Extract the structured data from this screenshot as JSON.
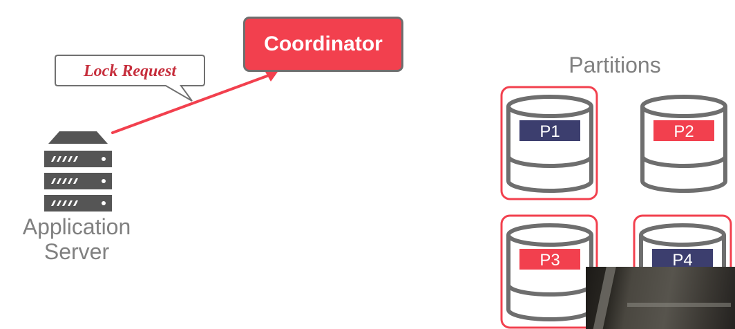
{
  "diagram": {
    "coordinator_label": "Coordinator",
    "callout_label": "Lock Request",
    "app_server_label": [
      "Application",
      "Server"
    ],
    "partitions_title": "Partitions",
    "partitions": [
      {
        "label": "P1",
        "band_color": "#3c3e6e",
        "highlighted": true
      },
      {
        "label": "P2",
        "band_color": "#f2404e",
        "highlighted": false
      },
      {
        "label": "P3",
        "band_color": "#f2404e",
        "highlighted": true
      },
      {
        "label": "P4",
        "band_color": "#3c3e6e",
        "highlighted": true
      }
    ],
    "colors": {
      "accent": "#f2404e",
      "navy": "#3c3e6e",
      "outline": "#6e6e6e",
      "label_gray": "#808080",
      "callout_text": "#c62e3c"
    },
    "icons": {
      "server": "server-rack-icon",
      "partition": "database-cylinder-icon",
      "video": "webcam-video-thumbnail"
    }
  }
}
